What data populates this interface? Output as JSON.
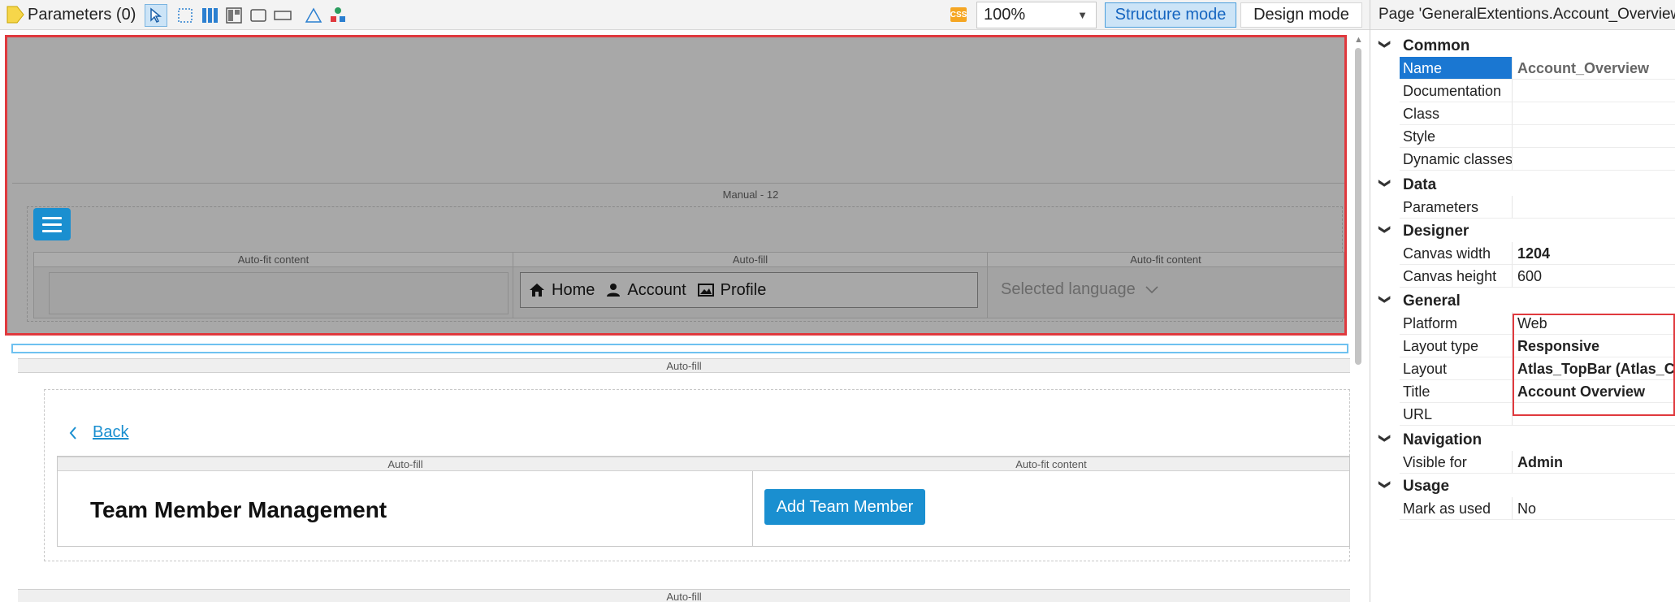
{
  "toolbar": {
    "parameters_label": "Parameters (0)",
    "icons": [
      "select-pointer-icon",
      "marquee-select-icon",
      "columns-icon",
      "layout-grid-icon",
      "container-icon",
      "panel-icon",
      "shape-icon",
      "widget-tree-icon"
    ],
    "css_badge": "CSS",
    "zoom": "100%",
    "structure_mode": "Structure mode",
    "design_mode": "Design mode"
  },
  "canvas": {
    "manual_label": "Manual - 12",
    "nav_columns": [
      "Auto-fit content",
      "Auto-fill",
      "Auto-fit content"
    ],
    "nav_items": [
      {
        "icon": "home-icon",
        "label": "Home"
      },
      {
        "icon": "user-icon",
        "label": "Account"
      },
      {
        "icon": "image-icon",
        "label": "Profile"
      }
    ],
    "language_placeholder": "Selected language",
    "main_autofill": "Auto-fill",
    "back_label": "Back",
    "split_columns": [
      "Auto-fill",
      "Auto-fit content"
    ],
    "page_heading": "Team Member Management",
    "add_button": "Add Team Member",
    "bottom_autofill": "Auto-fill"
  },
  "properties": {
    "title": "Page 'GeneralExtentions.Account_Overview'",
    "categories": [
      {
        "name": "Common",
        "rows": [
          {
            "name": "Name",
            "value": "Account_Overview"
          },
          {
            "name": "Documentation",
            "value": ""
          },
          {
            "name": "Class",
            "value": ""
          },
          {
            "name": "Style",
            "value": ""
          },
          {
            "name": "Dynamic classes",
            "value": ""
          }
        ]
      },
      {
        "name": "Data",
        "rows": [
          {
            "name": "Parameters",
            "value": ""
          }
        ]
      },
      {
        "name": "Designer",
        "rows": [
          {
            "name": "Canvas width",
            "value": "1204"
          },
          {
            "name": "Canvas height",
            "value": "600"
          }
        ]
      },
      {
        "name": "General",
        "rows": [
          {
            "name": "Platform",
            "value": "Web"
          },
          {
            "name": "Layout type",
            "value": "Responsive"
          },
          {
            "name": "Layout",
            "value": "Atlas_TopBar (Atlas_Core"
          },
          {
            "name": "Title",
            "value": "Account Overview"
          },
          {
            "name": "URL",
            "value": ""
          }
        ]
      },
      {
        "name": "Navigation",
        "rows": [
          {
            "name": "Visible for",
            "value": "Admin"
          }
        ]
      },
      {
        "name": "Usage",
        "rows": [
          {
            "name": "Mark as used",
            "value": "No"
          }
        ]
      }
    ]
  }
}
